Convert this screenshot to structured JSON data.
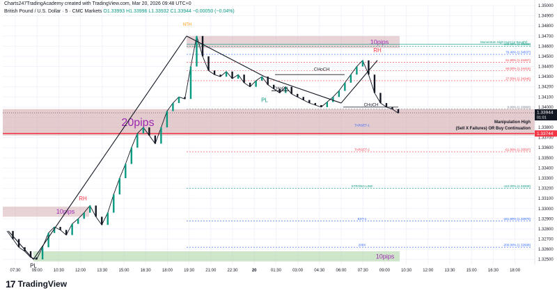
{
  "header": {
    "line1": "Charts247TradingAcademy created with TradingView.com, Mar 20, 2026 09:48 UTC+0",
    "line2_symbol": "British Pound / U.S. Dollar · 5 · CMC Markets",
    "line2_ohlc": "O1.33993 H1.33996 L1.33932 C1.33944 −0.00050 (−0.04%)"
  },
  "footer": {
    "brand": "TradingView",
    "mark": "17"
  },
  "chart_data": {
    "type": "line",
    "title": "",
    "xlabel": "",
    "ylabel": "",
    "ylim": [
      1.3245,
      1.35
    ],
    "price_ticks": [
      1.35,
      1.349,
      1.348,
      1.347,
      1.346,
      1.345,
      1.344,
      1.343,
      1.342,
      1.341,
      1.34,
      1.339,
      1.338,
      1.337,
      1.336,
      1.335,
      1.334,
      1.333,
      1.332,
      1.331,
      1.33,
      1.329,
      1.328,
      1.327,
      1.326,
      1.325
    ],
    "price_tick_labels": [
      "1.35000",
      "1.34900",
      "1.34800",
      "1.34700",
      "1.34600",
      "1.34500",
      "1.34400",
      "1.34300",
      "1.34200",
      "1.34100",
      "1.34000",
      "1.33900",
      "1.33800",
      "1.33700",
      "1.33600",
      "1.33500",
      "1.33400",
      "1.33300",
      "1.33200",
      "1.33100",
      "1.33000",
      "1.32900",
      "1.32800",
      "1.32700",
      "1.32600",
      "1.32500"
    ],
    "time_ticks": [
      "07:30",
      "09:00",
      "10:30",
      "12:00",
      "13:30",
      "15:00",
      "16:30",
      "18:00",
      "19:30",
      "21:00",
      "22:30",
      "20",
      "01:30",
      "03:00",
      "04:30",
      "06:00",
      "07:30",
      "09:00",
      "10:30",
      "12:00",
      "13:30",
      "15:00",
      "16:30",
      "18:00"
    ],
    "series": [
      {
        "values": [
          1.3278,
          1.327,
          1.3262,
          1.3258,
          1.3252,
          1.325,
          1.3262,
          1.3276,
          1.3282,
          1.3279,
          1.3274,
          1.3285,
          1.329,
          1.3296,
          1.3303,
          1.3292,
          1.3284,
          1.3296,
          1.3314,
          1.333,
          1.3344,
          1.336,
          1.3374,
          1.338,
          1.3372,
          1.3364,
          1.338,
          1.3396,
          1.3404,
          1.341,
          1.3408,
          1.344,
          1.347,
          1.345,
          1.3436,
          1.3432,
          1.343,
          1.3435,
          1.3428,
          1.3432,
          1.3424,
          1.342,
          1.3426,
          1.343,
          1.3422,
          1.3418,
          1.3414,
          1.342,
          1.3413,
          1.341,
          1.3407,
          1.3404,
          1.3402,
          1.34,
          1.3405,
          1.341,
          1.3416,
          1.3424,
          1.3432,
          1.344,
          1.3446,
          1.3432,
          1.3414,
          1.3404,
          1.34,
          1.3398,
          1.3394
        ]
      }
    ],
    "current_price": "1.33944",
    "current_price_countdown": "01:01",
    "prev_close_price": "1.33744",
    "zones": [
      {
        "label": "10pips",
        "from": 1.3458,
        "to": 1.347
      },
      {
        "label": "20pips",
        "from": 1.3372,
        "to": 1.3398
      },
      {
        "label": "10pips",
        "from": 1.3292,
        "to": 1.3302
      },
      {
        "label": "10pips",
        "from": 1.3248,
        "to": 1.3258
      }
    ],
    "levels": [
      {
        "label": "Momentum High Hunt (or Bought)",
        "price": 1.3462
      },
      {
        "label": "100.00% (1.34628)",
        "price": 1.346
      },
      {
        "label": "76.40% (1.34537)",
        "price": 1.3452
      },
      {
        "label": "61.80% (1.34467)",
        "price": 1.3444
      },
      {
        "label": "50.00% (1.34416)",
        "price": 1.3436
      },
      {
        "label": "27.50% (1.34346)",
        "price": 1.3426
      },
      {
        "label": "0.00% (1.33960)",
        "price": 1.3398
      },
      {
        "label": "TARGET-1",
        "price": 1.338
      },
      {
        "label": "-61.80% (1.33597)",
        "price": 1.3356
      },
      {
        "label": "TARGET-2",
        "price": 1.3356
      },
      {
        "label": "-110.00% (1.33328)",
        "price": 1.332
      },
      {
        "label": "STRONG-LINE",
        "price": 1.332
      },
      {
        "label": "-161.80% (1.32870)",
        "price": 1.3288
      },
      {
        "label": "EXT-1",
        "price": 1.3288
      },
      {
        "label": "-200.00% (1.32608)",
        "price": 1.3262
      },
      {
        "label": "200X",
        "price": 1.3262
      }
    ],
    "annotations": [
      {
        "text": "NTH"
      },
      {
        "text": "RH"
      },
      {
        "text": "RH"
      },
      {
        "text": "PL"
      },
      {
        "text": "PL"
      },
      {
        "text": "CHoCH"
      },
      {
        "text": "CHoCH"
      },
      {
        "text": "CHoCH"
      },
      {
        "text": "Manipulation High"
      },
      {
        "text": "(Sell X Failures) OR Buy Continuation"
      }
    ]
  }
}
